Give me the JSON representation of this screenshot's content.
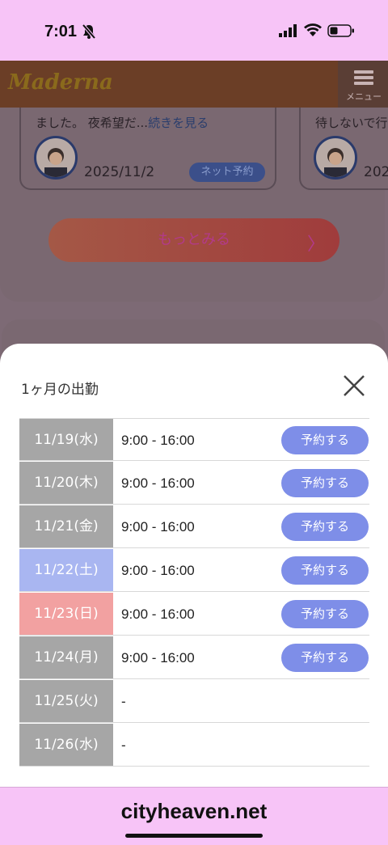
{
  "status_bar": {
    "time": "7:01"
  },
  "background_page": {
    "logo": "Maderna",
    "menu_label": "メニュー",
    "reviews": [
      {
        "snippet": "ました。 夜希望だ...",
        "more_link": "続きを見る",
        "date": "2025/11/2",
        "badge": "ネット予約"
      },
      {
        "snippet": "待しないで行",
        "date": "202"
      }
    ],
    "more_button": "もっとみる",
    "more_chevron": "〉"
  },
  "modal": {
    "title": "1ヶ月の出勤",
    "reserve_label": "予約する",
    "schedule": [
      {
        "date": "11/19(水)",
        "hours": "9:00 - 16:00",
        "reservable": true,
        "color": "#a6a6a6"
      },
      {
        "date": "11/20(木)",
        "hours": "9:00 - 16:00",
        "reservable": true,
        "color": "#a6a6a6"
      },
      {
        "date": "11/21(金)",
        "hours": "9:00 - 16:00",
        "reservable": true,
        "color": "#a6a6a6"
      },
      {
        "date": "11/22(土)",
        "hours": "9:00 - 16:00",
        "reservable": true,
        "color": "#a9b6f1"
      },
      {
        "date": "11/23(日)",
        "hours": "9:00 - 16:00",
        "reservable": true,
        "color": "#f2a1a1"
      },
      {
        "date": "11/24(月)",
        "hours": "9:00 - 16:00",
        "reservable": true,
        "color": "#a6a6a6"
      },
      {
        "date": "11/25(火)",
        "hours": "-",
        "reservable": false,
        "color": "#a6a6a6"
      },
      {
        "date": "11/26(水)",
        "hours": "-",
        "reservable": false,
        "color": "#a6a6a6"
      }
    ]
  },
  "browser": {
    "domain": "cityheaven.net"
  },
  "colors": {
    "accent": "#7e8ee8",
    "status_bar": "#f7c4f7",
    "saturday": "#a9b6f1",
    "sunday": "#f2a1a1",
    "weekday": "#a6a6a6"
  }
}
